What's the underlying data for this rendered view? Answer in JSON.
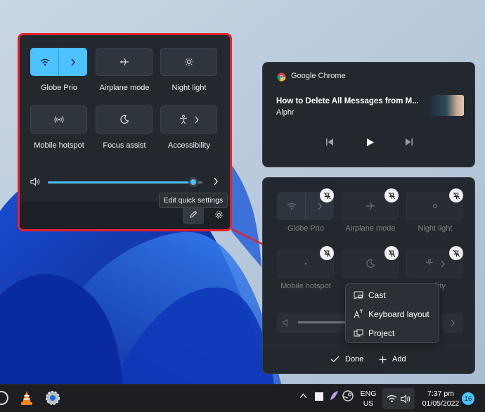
{
  "quick_settings": {
    "tiles": [
      {
        "label": "Globe Prio",
        "icon": "wifi-icon",
        "expand": "chevron-right-icon",
        "active": true
      },
      {
        "label": "Airplane mode",
        "icon": "airplane-icon",
        "active": false
      },
      {
        "label": "Night light",
        "icon": "night-light-icon",
        "active": false
      },
      {
        "label": "Mobile hotspot",
        "icon": "hotspot-icon",
        "active": false
      },
      {
        "label": "Focus assist",
        "icon": "moon-icon",
        "active": false
      },
      {
        "label": "Accessibility",
        "icon": "accessibility-icon",
        "expand": "chevron-right-icon",
        "active": false
      }
    ],
    "volume": {
      "level": 0.85,
      "icon": "speaker-icon"
    },
    "tooltip": "Edit quick settings",
    "footer": {
      "edit_icon": "pencil-icon",
      "settings_icon": "gear-icon"
    },
    "highlight_color": "#e8212b",
    "accent_color": "#4cc2ff"
  },
  "media": {
    "app": "Google Chrome",
    "app_icon": "chrome-icon",
    "title": "How to Delete All Messages from M...",
    "source": "Alphr",
    "controls": [
      "previous-icon",
      "play-icon",
      "next-icon"
    ]
  },
  "edit_panel": {
    "tiles": [
      {
        "label": "Globe Prio"
      },
      {
        "label": "Airplane mode"
      },
      {
        "label": "Night light"
      },
      {
        "label": "Mobile hotspot"
      },
      {
        "label": ""
      },
      {
        "label": "ility"
      }
    ],
    "done_label": "Done",
    "add_label": "Add"
  },
  "context_menu": {
    "items": [
      {
        "label": "Cast",
        "icon": "cast-icon"
      },
      {
        "label": "Keyboard layout",
        "icon": "keyboard-layout-icon"
      },
      {
        "label": "Project",
        "icon": "project-icon"
      }
    ]
  },
  "taskbar": {
    "lang_top": "ENG",
    "lang_bottom": "US",
    "time": "7:37 pm",
    "date": "01/05/2022",
    "notification_count": "16"
  }
}
